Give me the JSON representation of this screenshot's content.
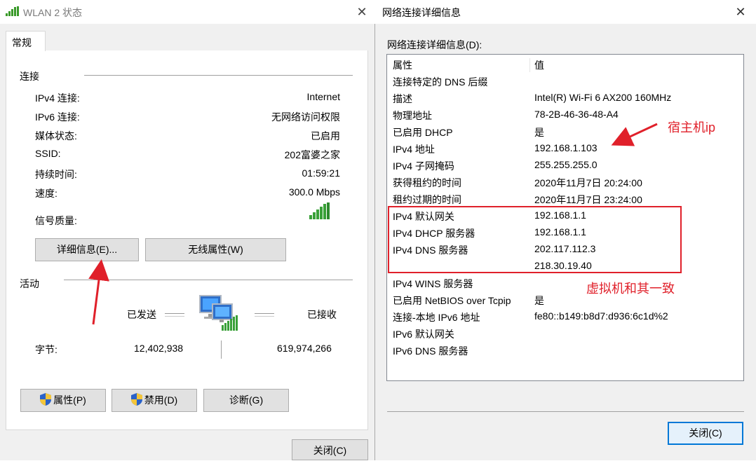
{
  "left_window": {
    "title": "WLAN 2 状态",
    "tab": "常规",
    "connection_section": "连接",
    "rows": [
      {
        "label": "IPv4 连接:",
        "value": "Internet"
      },
      {
        "label": "IPv6 连接:",
        "value": "无网络访问权限"
      },
      {
        "label": "媒体状态:",
        "value": "已启用"
      },
      {
        "label": "SSID:",
        "value": "202富婆之家"
      },
      {
        "label": "持续时间:",
        "value": "01:59:21"
      },
      {
        "label": "速度:",
        "value": "300.0 Mbps"
      }
    ],
    "signal_label": "信号质量:",
    "details_button": "详细信息(E)...",
    "wireless_button": "无线属性(W)",
    "activity_section": "活动",
    "sent_label": "已发送",
    "received_label": "已接收",
    "bytes_label": "字节:",
    "bytes_sent": "12,402,938",
    "bytes_received": "619,974,266",
    "properties_button": "属性(P)",
    "disable_button": "禁用(D)",
    "diagnose_button": "诊断(G)",
    "close_button": "关闭(C)"
  },
  "right_window": {
    "title": "网络连接详细信息",
    "caption": "网络连接详细信息(D):",
    "col_property": "属性",
    "col_value": "值",
    "rows": [
      {
        "property": "连接特定的 DNS 后缀",
        "value": ""
      },
      {
        "property": "描述",
        "value": "Intel(R) Wi-Fi 6 AX200 160MHz"
      },
      {
        "property": "物理地址",
        "value": "78-2B-46-36-48-A4"
      },
      {
        "property": "已启用 DHCP",
        "value": "是"
      },
      {
        "property": "IPv4 地址",
        "value": "192.168.1.103"
      },
      {
        "property": "IPv4 子网掩码",
        "value": "255.255.255.0"
      },
      {
        "property": "获得租约的时间",
        "value": "2020年11月7日 20:24:00"
      },
      {
        "property": "租约过期的时间",
        "value": "2020年11月7日 23:24:00"
      },
      {
        "property": "IPv4 默认网关",
        "value": "192.168.1.1"
      },
      {
        "property": "IPv4 DHCP 服务器",
        "value": "192.168.1.1"
      },
      {
        "property": "IPv4 DNS 服务器",
        "value": "202.117.112.3"
      },
      {
        "property": "",
        "value": "218.30.19.40"
      },
      {
        "property": "IPv4 WINS 服务器",
        "value": ""
      },
      {
        "property": "已启用 NetBIOS over Tcpip",
        "value": "是"
      },
      {
        "property": "连接-本地 IPv6 地址",
        "value": "fe80::b149:b8d7:d936:6c1d%2"
      },
      {
        "property": "IPv6 默认网关",
        "value": ""
      },
      {
        "property": "IPv6 DNS 服务器",
        "value": ""
      }
    ],
    "close_button": "关闭(C)"
  },
  "annotations": {
    "host_ip_note": "宿主机ip",
    "vm_same_note": "虚拟机和其一致",
    "color": "#e0202a"
  }
}
